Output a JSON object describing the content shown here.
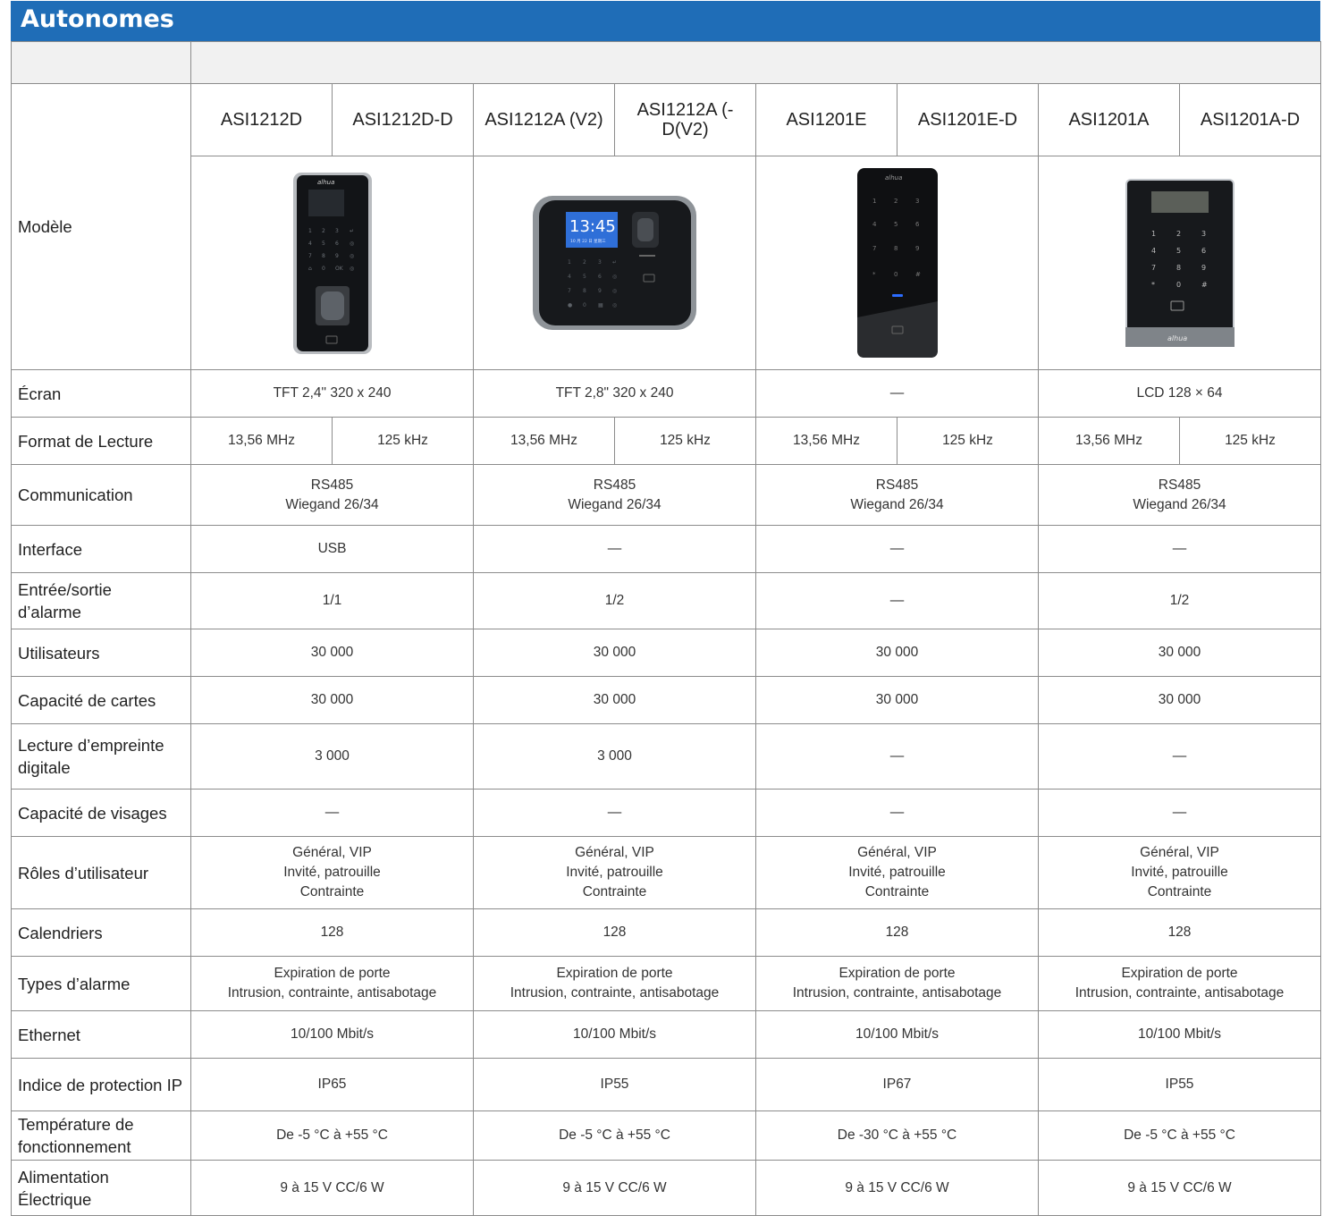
{
  "header": {
    "title": "Autonomes"
  },
  "models": [
    "ASI1212D",
    "ASI1212D-D",
    "ASI1212A (V2)",
    "ASI1212A (-D(V2)",
    "ASI1201E",
    "ASI1201E-D",
    "ASI1201A",
    "ASI1201A-D"
  ],
  "device_text": {
    "brand": "alhua",
    "clock": "13:45",
    "date": "10 月 22 日 星期三"
  },
  "rows": {
    "modele": "Modèle",
    "ecran": {
      "label": "Écran",
      "values": [
        "TFT 2,4\" 320 x 240",
        "TFT 2,8\" 320 x 240",
        "—",
        "LCD 128 × 64"
      ]
    },
    "format": {
      "label": "Format de Lecture",
      "values": [
        "13,56 MHz",
        "125 kHz",
        "13,56 MHz",
        "125 kHz",
        "13,56 MHz",
        "125 kHz",
        "13,56 MHz",
        "125 kHz"
      ]
    },
    "communication": {
      "label": "Communication",
      "line1": "RS485",
      "line2": "Wiegand 26/34"
    },
    "interface": {
      "label": "Interface",
      "values": [
        "USB",
        "—",
        "—",
        "—"
      ]
    },
    "alarme_io": {
      "label_line1": "Entrée/sortie",
      "label_line2": "d’alarme",
      "values": [
        "1/1",
        "1/2",
        "—",
        "1/2"
      ]
    },
    "utilisateurs": {
      "label": "Utilisateurs",
      "values": [
        "30 000",
        "30 000",
        "30 000",
        "30 000"
      ]
    },
    "cartes": {
      "label": "Capacité de cartes",
      "values": [
        "30 000",
        "30 000",
        "30 000",
        "30 000"
      ]
    },
    "empreinte": {
      "label_line1": "Lecture d’empreinte",
      "label_line2": "digitale",
      "values": [
        "3 000",
        "3 000",
        "—",
        "—"
      ]
    },
    "visages": {
      "label": "Capacité de visages",
      "values": [
        "—",
        "—",
        "—",
        "—"
      ]
    },
    "roles": {
      "label": "Rôles d’utilisateur",
      "line1": "Général, VIP",
      "line2": "Invité, patrouille",
      "line3": "Contrainte"
    },
    "calendriers": {
      "label": "Calendriers",
      "values": [
        "128",
        "128",
        "128",
        "128"
      ]
    },
    "types_alarme": {
      "label": "Types d’alarme",
      "line1": "Expiration de porte",
      "line2": "Intrusion, contrainte, antisabotage"
    },
    "ethernet": {
      "label": "Ethernet",
      "values": [
        "10/100 Mbit/s",
        "10/100 Mbit/s",
        "10/100 Mbit/s",
        "10/100 Mbit/s"
      ]
    },
    "ip": {
      "label": "Indice de protection IP",
      "values": [
        "IP65",
        "IP55",
        "IP67",
        "IP55"
      ]
    },
    "temperature": {
      "label_line1": "Température de",
      "label_line2": "fonctionnement",
      "values": [
        "De -5 °C à +55 °C",
        "De -5 °C à +55 °C",
        "De -30 °C à +55 °C",
        "De -5 °C à +55 °C"
      ]
    },
    "alimentation": {
      "label_line1": "Alimentation",
      "label_line2": "Électrique",
      "values": [
        "9 à 15 V CC/6 W",
        "9 à 15 V CC/6 W",
        "9 à 15 V CC/6 W",
        "9 à 15 V CC/6 W"
      ]
    }
  },
  "colors": {
    "header_bg": "#1f6db7",
    "grey_row": "#f1f1f1",
    "border": "#8c8c8c"
  }
}
